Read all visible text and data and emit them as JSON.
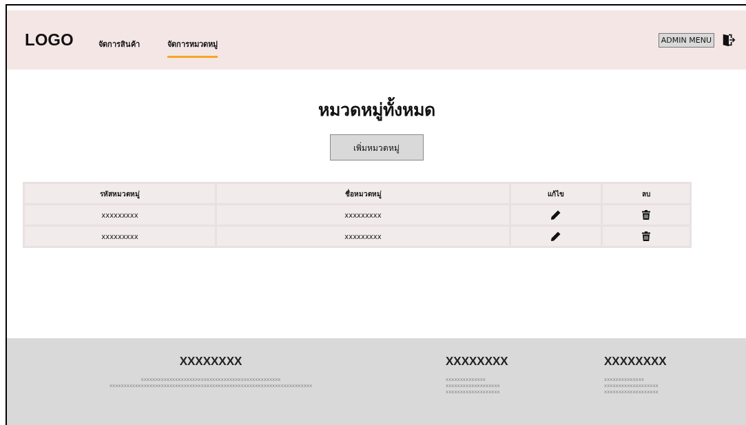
{
  "header": {
    "logo": "LOGO",
    "nav": [
      {
        "label": "จัดการสินค้า",
        "selected": false
      },
      {
        "label": "จัดการหมวดหมู่",
        "selected": true
      }
    ],
    "admin_menu": "ADMIN MENU"
  },
  "title": "หมวดหมู่ทั้งหมด",
  "add_button": "เพิ่มหมวดหมู่",
  "table": {
    "columns": [
      "รหัสหมวดหมู่",
      "ชื่อหมวดหมู่",
      "แก้ไข",
      "ลบ"
    ],
    "rows": [
      {
        "code": "xxxxxxxxx",
        "name": "xxxxxxxxx"
      },
      {
        "code": "xxxxxxxxx",
        "name": "xxxxxxxxx"
      }
    ]
  },
  "footer": [
    {
      "heading": "XXXXXXXX",
      "lines": [
        "xxxxxxxxxxxxxxxxxxxxxxxxxxxxxxxxxxxxxxxxxxxxxxxxx",
        "xxxxxxxxxxxxxxxxxxxxxxxxxxxxxxxxxxxxxxxxxxxxxxxxxxxxxxxxxxxxxxxxxxxxxxx"
      ]
    },
    {
      "heading": "XXXXXXXX",
      "lines": [
        "xxxxxxxxxxxxxx",
        "xxxxxxxxxxxxxxxxxxx",
        "xxxxxxxxxxxxxxxxxxx"
      ]
    },
    {
      "heading": "XXXXXXXX",
      "lines": [
        "xxxxxxxxxxxxxx",
        "xxxxxxxxxxxxxxxxxxx",
        "xxxxxxxxxxxxxxxxxxx"
      ]
    }
  ]
}
